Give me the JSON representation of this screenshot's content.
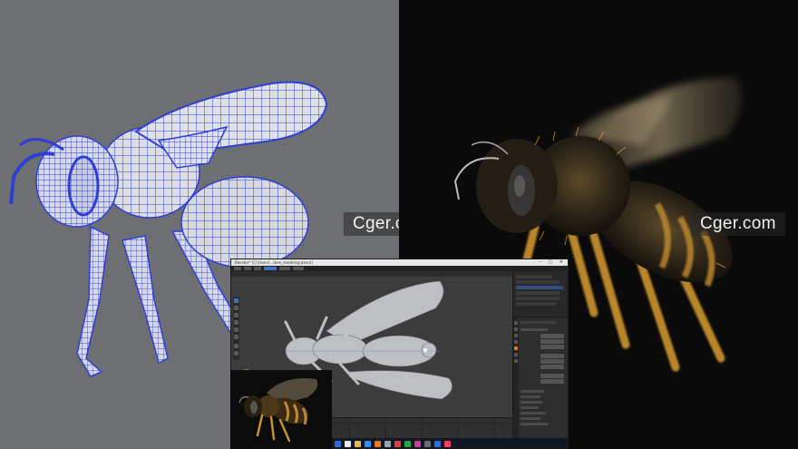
{
  "watermarks": {
    "left": "Cger.com",
    "right": "Cger.com"
  },
  "blender": {
    "title_bar": "Blender* [C:\\Users\\...\\bee_modeling.blend]",
    "window_controls": "– ▢ ✕",
    "viewport_corner_letter": "R",
    "clock_time": "",
    "clock_date": ""
  },
  "colors": {
    "left_background": "#6e6f72",
    "right_background": "#0a0a0a",
    "wireframe": "#2f3fd4",
    "blender_accent": "#4772b3",
    "taskbar": "#101828"
  },
  "icons": {
    "taskbar": [
      "windows-start-icon",
      "search-icon",
      "folder-icon",
      "browser-icon",
      "blender-icon",
      "app-icon"
    ]
  }
}
